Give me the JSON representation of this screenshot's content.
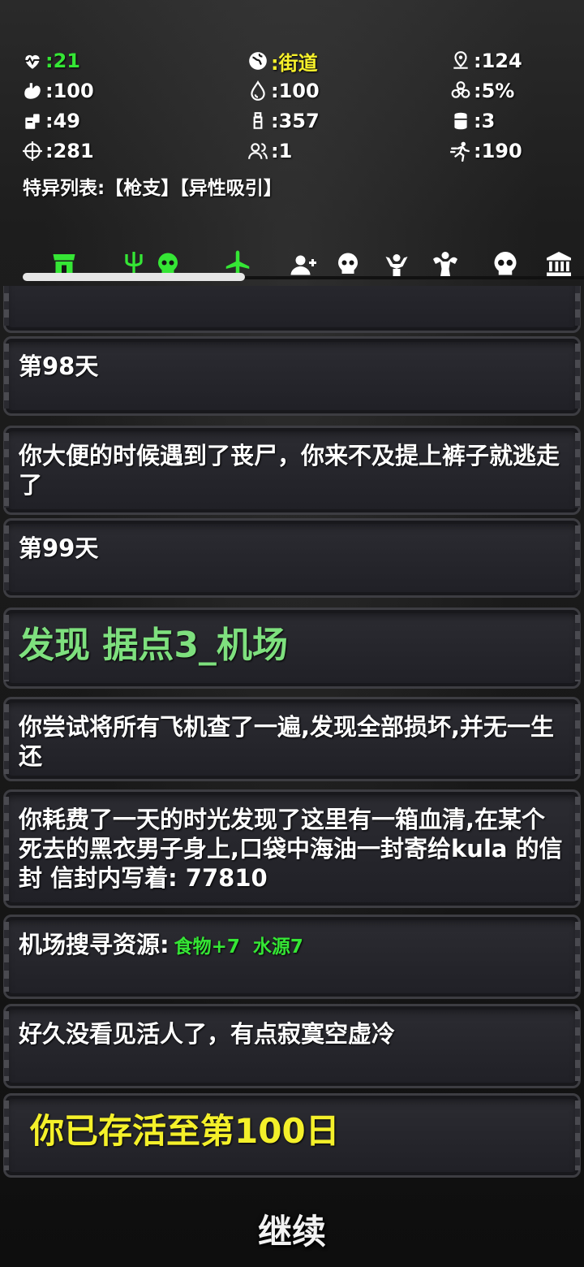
{
  "stats": {
    "health": ":21",
    "location": ":街道",
    "distance": ":124",
    "food": ":100",
    "water": ":100",
    "infection": ":5%",
    "supplies": ":49",
    "bullets": ":357",
    "cans": ":3",
    "aim": ":281",
    "companions": ":1",
    "speed": ":190"
  },
  "traits": "特异列表:【枪支】【异性吸引】",
  "tabs": [
    {
      "name": "shop",
      "color": "#35e635"
    },
    {
      "name": "trident-skull",
      "color": "#35e635"
    },
    {
      "name": "airplane",
      "color": "#35e635"
    },
    {
      "name": "add-user",
      "color": "#ffffff"
    },
    {
      "name": "skull",
      "color": "#ffffff"
    },
    {
      "name": "hands",
      "color": "#ffffff"
    },
    {
      "name": "muscle",
      "color": "#ffffff"
    },
    {
      "name": "skull-large",
      "color": "#ffffff"
    },
    {
      "name": "bank",
      "color": "#ffffff"
    }
  ],
  "log": {
    "day98": "第98天",
    "event1": "你大便的时候遇到了丧尸，你来不及提上裤子就逃走了",
    "day99": "第99天",
    "discover": "发现 据点3_机场",
    "event2": "你尝试将所有飞机查了一遍,发现全部损坏,并无一生还",
    "event3": "你耗费了一天的时光发现了这里有一箱血清,在某个死去的黑衣男子身上,口袋中海油一封寄给kula 的信封 信封内写着: 77810",
    "search_label": "机场搜寻资源:",
    "search_food": "食物+7",
    "search_water": "水源7",
    "event4": "好久没看见活人了，有点寂寞空虚冷",
    "survived": "你已存活至第100日"
  },
  "continue_label": "继续"
}
